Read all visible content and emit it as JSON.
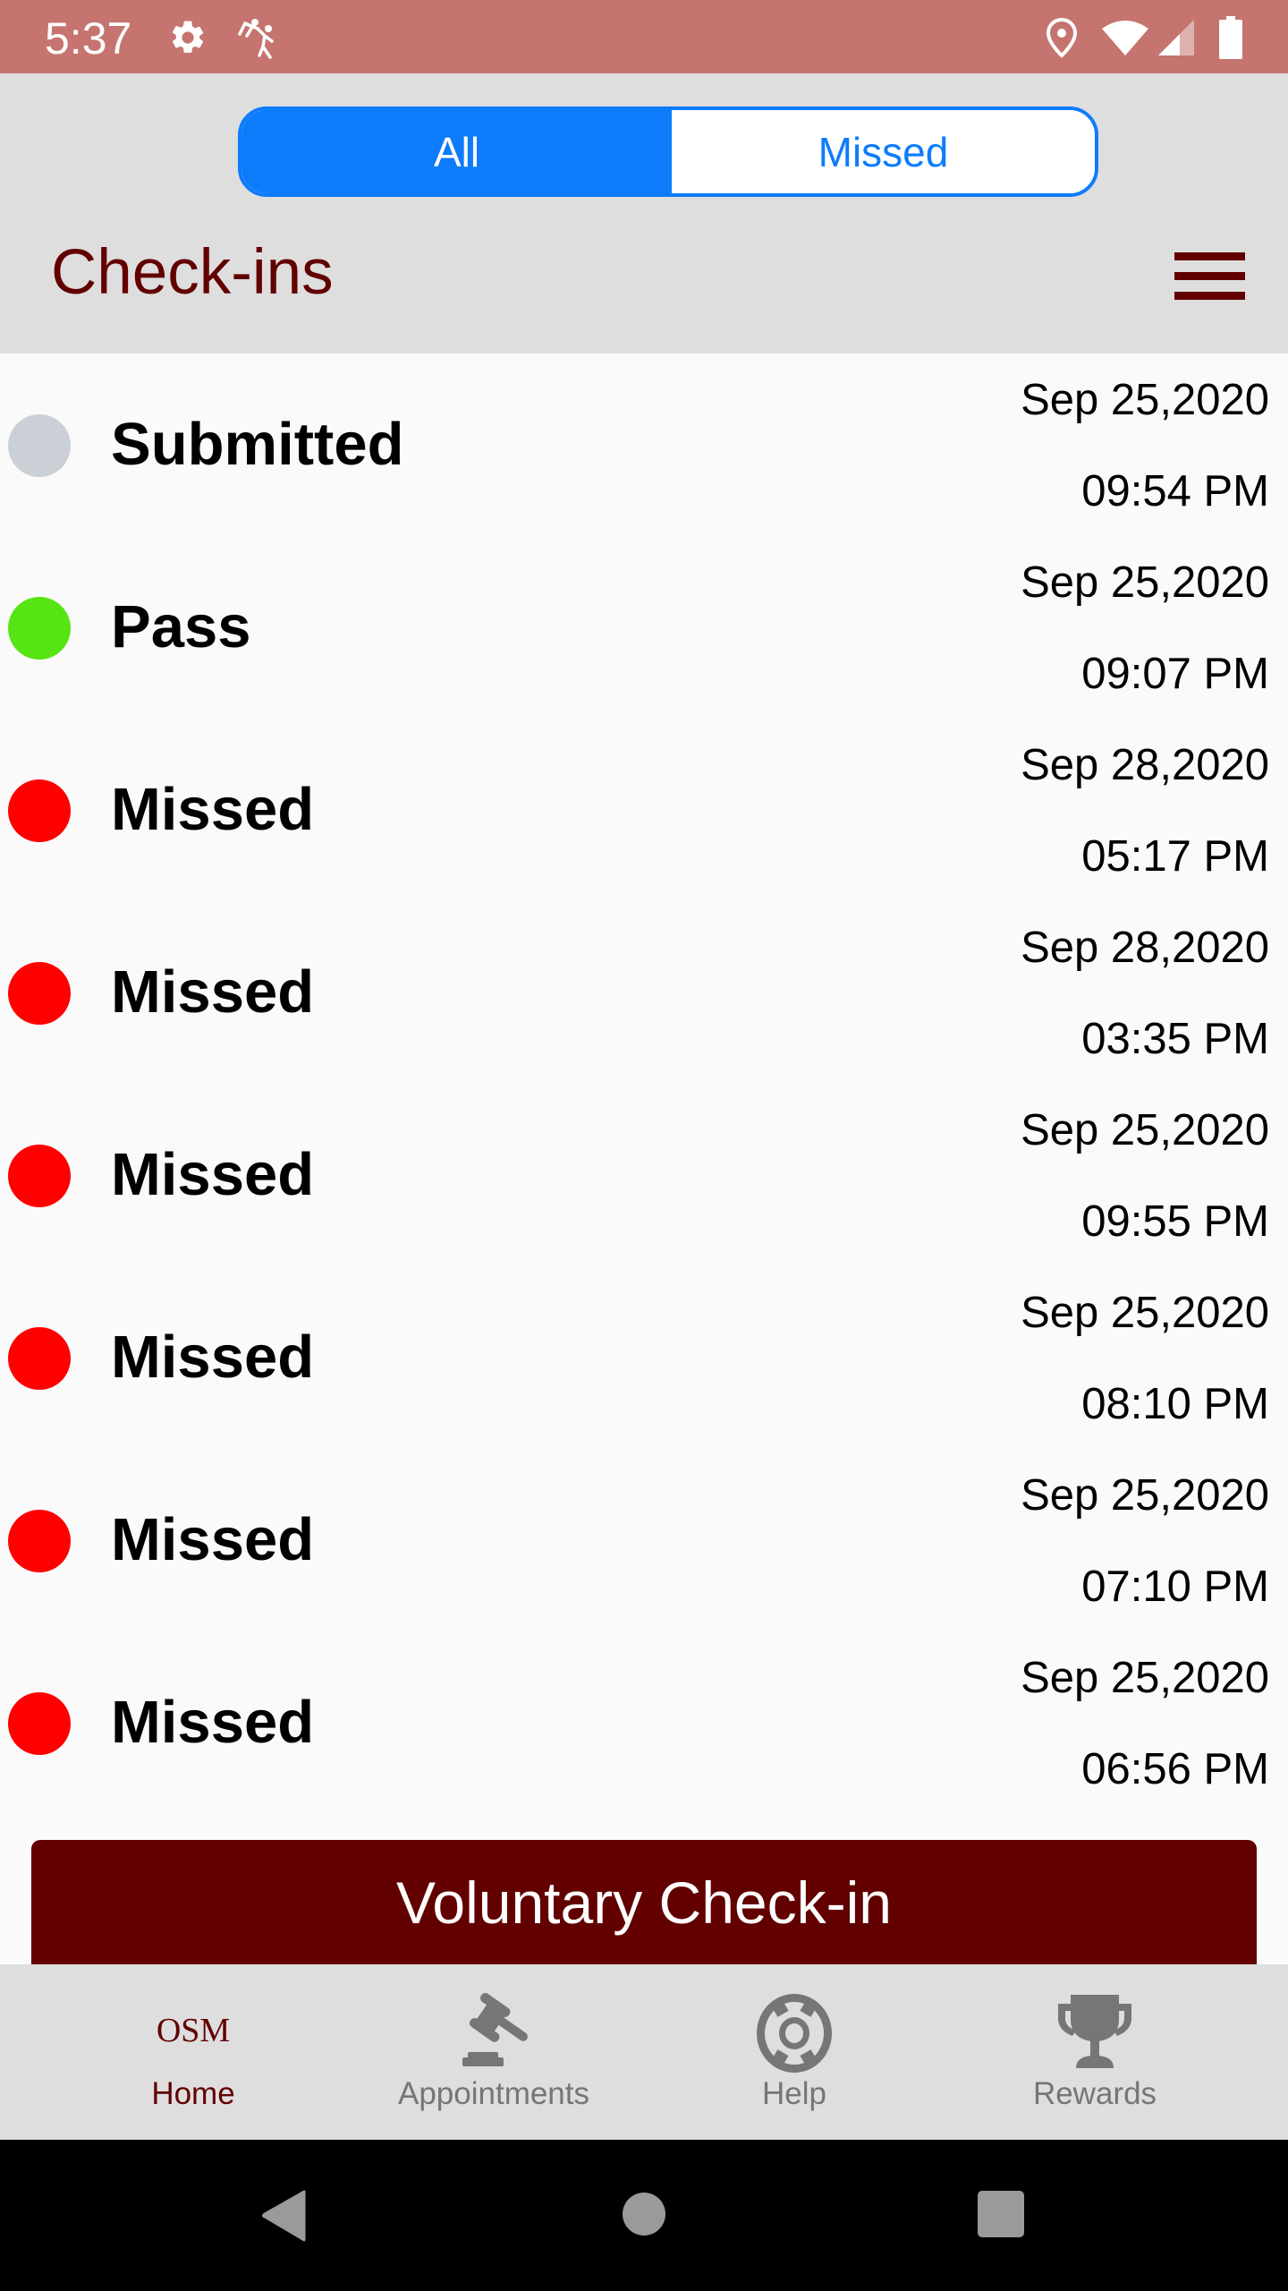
{
  "status_bar": {
    "time": "5:37",
    "left_icons": [
      "gear-icon",
      "helping-hand-icon"
    ],
    "right_icons": [
      "location-icon",
      "wifi-icon",
      "cell-signal-icon",
      "battery-icon"
    ]
  },
  "filter": {
    "options": [
      {
        "label": "All",
        "selected": true
      },
      {
        "label": "Missed",
        "selected": false
      }
    ]
  },
  "header": {
    "title": "Check-ins",
    "menu_icon": "hamburger-menu-icon"
  },
  "colors": {
    "status_bar": "#c5746f",
    "accent_blue": "#0d7cfb",
    "brand_maroon": "#620000",
    "submitted": "#cbd0d7",
    "pass": "#57e414",
    "missed": "#ff0000",
    "nav_inactive": "#767676"
  },
  "checkins": [
    {
      "status": "Submitted",
      "date": "Sep 25,2020",
      "time": "09:54 PM",
      "color": "#cbd0d7"
    },
    {
      "status": "Pass",
      "date": "Sep 25,2020",
      "time": "09:07 PM",
      "color": "#57e414"
    },
    {
      "status": "Missed",
      "date": "Sep 28,2020",
      "time": "05:17 PM",
      "color": "#ff0000"
    },
    {
      "status": "Missed",
      "date": "Sep 28,2020",
      "time": "03:35 PM",
      "color": "#ff0000"
    },
    {
      "status": "Missed",
      "date": "Sep 25,2020",
      "time": "09:55 PM",
      "color": "#ff0000"
    },
    {
      "status": "Missed",
      "date": "Sep 25,2020",
      "time": "08:10 PM",
      "color": "#ff0000"
    },
    {
      "status": "Missed",
      "date": "Sep 25,2020",
      "time": "07:10 PM",
      "color": "#ff0000"
    },
    {
      "status": "Missed",
      "date": "Sep 25,2020",
      "time": "06:56 PM",
      "color": "#ff0000"
    }
  ],
  "cta": {
    "label": "Voluntary Check-in"
  },
  "bottom_nav": {
    "items": [
      {
        "label": "Home",
        "icon": "osm-logo",
        "icon_text": "OSM",
        "active": true
      },
      {
        "label": "Appointments",
        "icon": "gavel-icon",
        "active": false
      },
      {
        "label": "Help",
        "icon": "lifebuoy-icon",
        "active": false
      },
      {
        "label": "Rewards",
        "icon": "trophy-icon",
        "active": false
      }
    ]
  },
  "system_nav": {
    "buttons": [
      "back-icon",
      "home-icon",
      "recents-icon"
    ]
  }
}
